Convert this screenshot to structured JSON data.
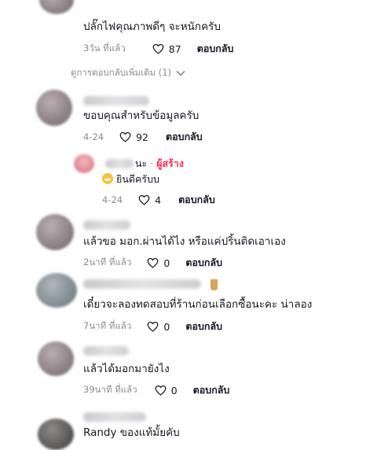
{
  "comments": [
    {
      "text": "ปลั๊กไฟคุณภาพดีๆ จะหนักครับ",
      "time": "3วัน ที่แล้ว",
      "likes": "87",
      "reply": "ตอบกลับ"
    },
    {
      "text": "ขอบคุณสำหรับข้อมูลครับ",
      "time": "4-24",
      "likes": "92",
      "reply": "ตอบกลับ"
    },
    {
      "text": "แล้วขอ มอก.ผ่านได้ไง หรือแค่ปริ้นติดเอาเอง",
      "time": "2นาที ที่แล้ว",
      "likes": "0",
      "reply": "ตอบกลับ"
    },
    {
      "text": "เดี๋ยวจะลองทดสอบที่ร้านก่อนเลือกซื้อนะคะ น่าลอง",
      "time": "7นาที ที่แล้ว",
      "likes": "0",
      "reply": "ตอบกลับ"
    },
    {
      "text": "แล้วได้มอกมายังไง",
      "time": "39นาที ที่แล้ว",
      "likes": "0",
      "reply": "ตอบกลับ"
    },
    {
      "text": "Randy ของแท้มั้ยคับ"
    }
  ],
  "more_replies": "ดูการตอบกลับเพิ่มเติม (1)",
  "creator_reply": {
    "name_suffix": "นะ",
    "separator": "·",
    "creator_label": "ผู้สร้าง",
    "text": "ยินดีครับบ",
    "time": "4-24",
    "likes": "4",
    "reply": "ตอบกลับ"
  },
  "icons": {
    "heart": "heart-outline-icon",
    "chevron": "chevron-down-icon",
    "emoji": "grinning-emoji-icon",
    "drink": "bubble-tea-icon"
  },
  "colors": {
    "text": "#161823",
    "meta": "#8a8b91",
    "creator": "#fe2c55"
  }
}
